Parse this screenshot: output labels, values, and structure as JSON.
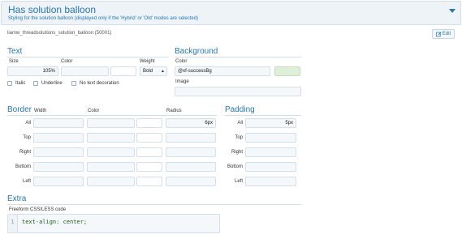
{
  "header": {
    "title": "Has solution balloon",
    "subtitle": "Styling for the solution balloon (displayed only if the 'Hybrid' or 'Old' modes are selected)"
  },
  "meta": {
    "identifier": "liamw_threadsolutions_solution_balloon (50001)",
    "edit_label": "Edit"
  },
  "text": {
    "title": "Text",
    "size_label": "Size",
    "size_value": "105%",
    "color_label": "Color",
    "weight_label": "Weight",
    "weight_value": "Bold",
    "italic_label": "Italic",
    "underline_label": "Underline",
    "no_decoration_label": "No text decoration"
  },
  "background": {
    "title": "Background",
    "color_label": "Color",
    "color_value": "@xf-successBg",
    "swatch": "#dff0d8",
    "image_label": "Image"
  },
  "border": {
    "title": "Border",
    "width_label": "Width",
    "color_label": "Color",
    "radius_label": "Radius",
    "rows": [
      "All",
      "Top",
      "Right",
      "Bottom",
      "Left"
    ],
    "radius_all_value": "6px"
  },
  "padding": {
    "title": "Padding",
    "rows": [
      "All",
      "Top",
      "Right",
      "Bottom",
      "Left"
    ],
    "all_value": "5px"
  },
  "extra": {
    "title": "Extra",
    "code_label": "Freeform CSS/LESS code",
    "line_number": "1",
    "code": "text-align: center;"
  },
  "colors": {
    "accent": "#2577b1",
    "header_bg": "#eef3f8",
    "input_bg": "#f5f8fb",
    "border": "#d3dfec"
  }
}
